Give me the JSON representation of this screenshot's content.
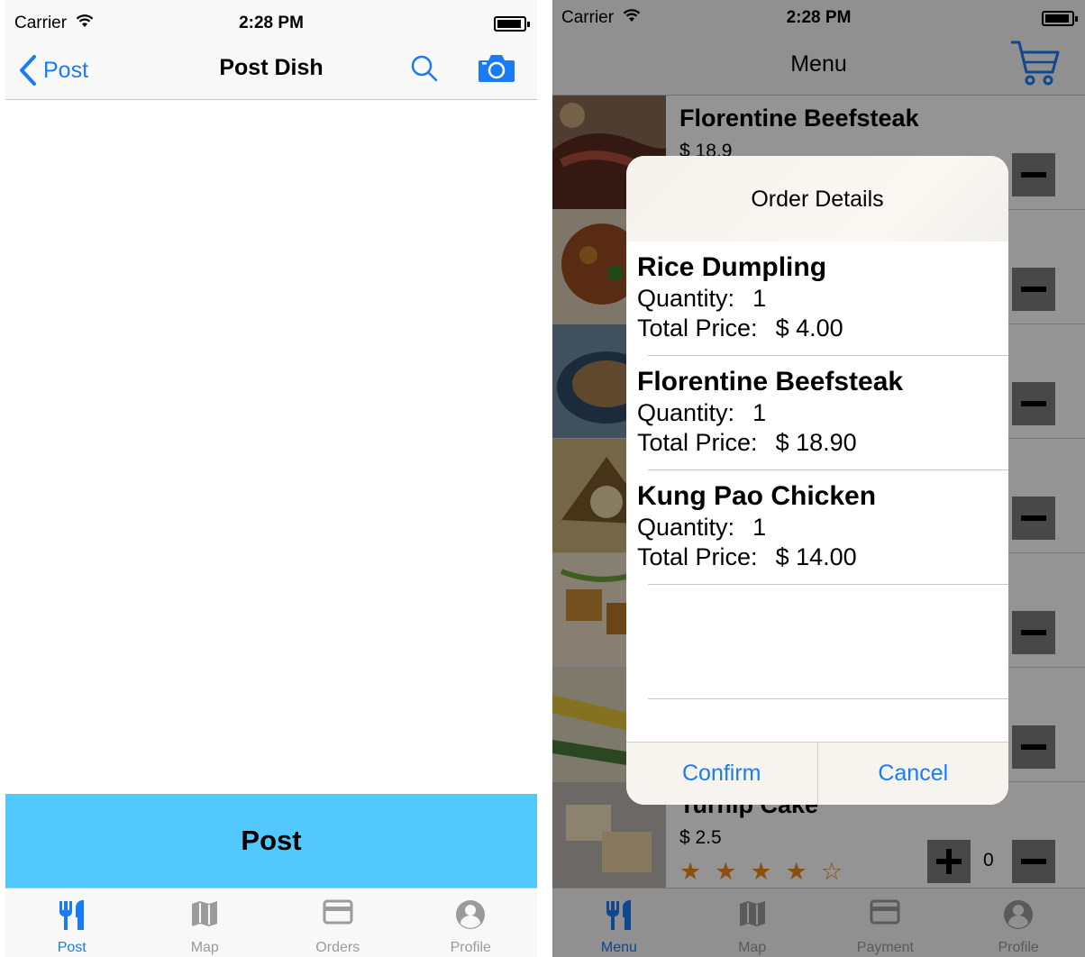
{
  "left": {
    "status": {
      "carrier": "Carrier",
      "time": "2:28 PM"
    },
    "nav": {
      "back_label": "Post",
      "title": "Post Dish",
      "icons": [
        "search-icon",
        "camera-icon"
      ]
    },
    "post_button": "Post",
    "tabs": [
      {
        "label": "Post",
        "icon": "fork-knife-icon",
        "active": true
      },
      {
        "label": "Map",
        "icon": "map-icon",
        "active": false
      },
      {
        "label": "Orders",
        "icon": "card-icon",
        "active": false
      },
      {
        "label": "Profile",
        "icon": "person-icon",
        "active": false
      }
    ]
  },
  "right": {
    "status": {
      "carrier": "Carrier",
      "time": "2:28 PM"
    },
    "nav": {
      "title": "Menu",
      "icons": [
        "cart-icon"
      ]
    },
    "menu": [
      {
        "name": "Florentine Beefsteak",
        "price": "$ 18.9"
      },
      {
        "name": "Turnip Cake",
        "price": "$ 2.5",
        "quantity": "0",
        "rating": 4,
        "max_rating": 5
      }
    ],
    "alert": {
      "title": "Order Details",
      "quantity_label": "Quantity:",
      "total_label": "Total Price:",
      "items": [
        {
          "name": "Rice Dumpling",
          "quantity": "1",
          "total": "$ 4.00"
        },
        {
          "name": "Florentine Beefsteak",
          "quantity": "1",
          "total": "$ 18.90"
        },
        {
          "name": "Kung Pao Chicken",
          "quantity": "1",
          "total": "$ 14.00"
        }
      ],
      "confirm_label": "Confirm",
      "cancel_label": "Cancel"
    },
    "tabs": [
      {
        "label": "Menu",
        "icon": "fork-knife-icon",
        "active": true
      },
      {
        "label": "Map",
        "icon": "map-icon",
        "active": false
      },
      {
        "label": "Payment",
        "icon": "card-icon",
        "active": false
      },
      {
        "label": "Profile",
        "icon": "person-icon",
        "active": false
      }
    ]
  },
  "colors": {
    "accent": "#1a7cf5",
    "post_button": "#53c8fc",
    "star": "#f08a1c",
    "inactive_tab": "#9b9b9b"
  }
}
